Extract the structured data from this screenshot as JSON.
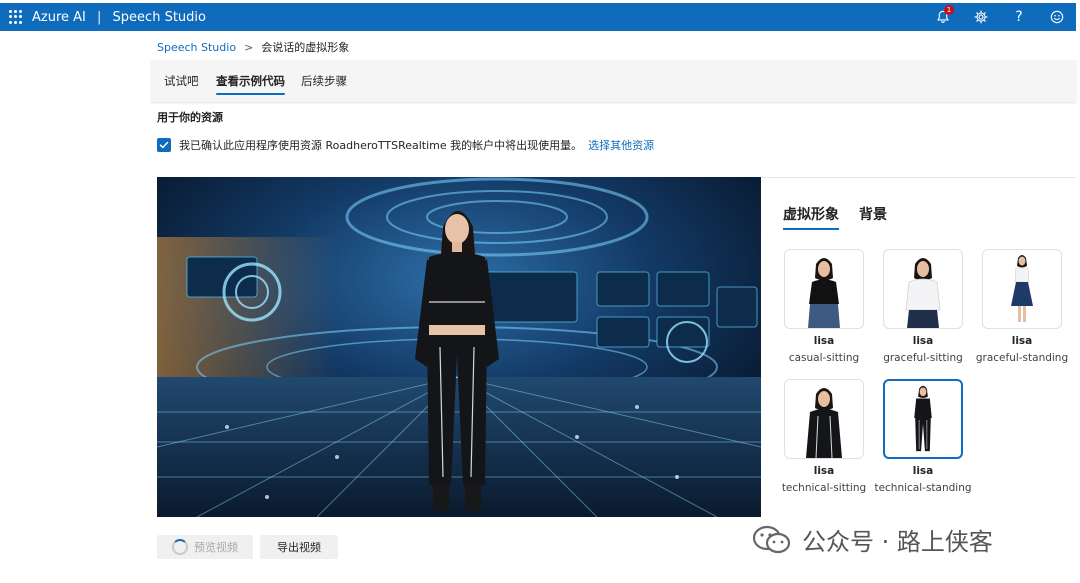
{
  "header": {
    "brand": "Azure AI",
    "separator": "|",
    "product": "Speech Studio",
    "notification_count": "1",
    "icons": [
      "app-launcher-icon",
      "bell-icon",
      "gear-icon",
      "help-icon",
      "smiley-icon"
    ],
    "help_glyph": "?"
  },
  "breadcrumb": {
    "root": "Speech Studio",
    "separator": ">",
    "current": "会说话的虚拟形象"
  },
  "tabs": [
    {
      "label": "试试吧",
      "active": false
    },
    {
      "label": "查看示例代码",
      "active": true
    },
    {
      "label": "后续步骤",
      "active": false
    }
  ],
  "resource": {
    "title": "用于你的资源",
    "checked": true,
    "confirm_text": "我已确认此应用程序使用资源 RoadheroTTSRealtime 我的帐户中将出现使用量。",
    "choose_link": "选择其他资源"
  },
  "panel": {
    "tabs": [
      {
        "label": "虚拟形象",
        "active": true
      },
      {
        "label": "背景",
        "active": false
      }
    ],
    "avatars": [
      {
        "name": "lisa",
        "style": "casual-sitting",
        "selected": false
      },
      {
        "name": "lisa",
        "style": "graceful-sitting",
        "selected": false
      },
      {
        "name": "lisa",
        "style": "graceful-standing",
        "selected": false
      },
      {
        "name": "lisa",
        "style": "technical-sitting",
        "selected": false
      },
      {
        "name": "lisa",
        "style": "technical-standing",
        "selected": true
      }
    ]
  },
  "buttons": {
    "preview": "预览视频",
    "export": "导出视频"
  },
  "watermark": "公众号 · 路上侠客",
  "colors": {
    "accent": "#0f6cbd",
    "topbar": "#0f6cbd",
    "notification": "#c50f1f"
  }
}
